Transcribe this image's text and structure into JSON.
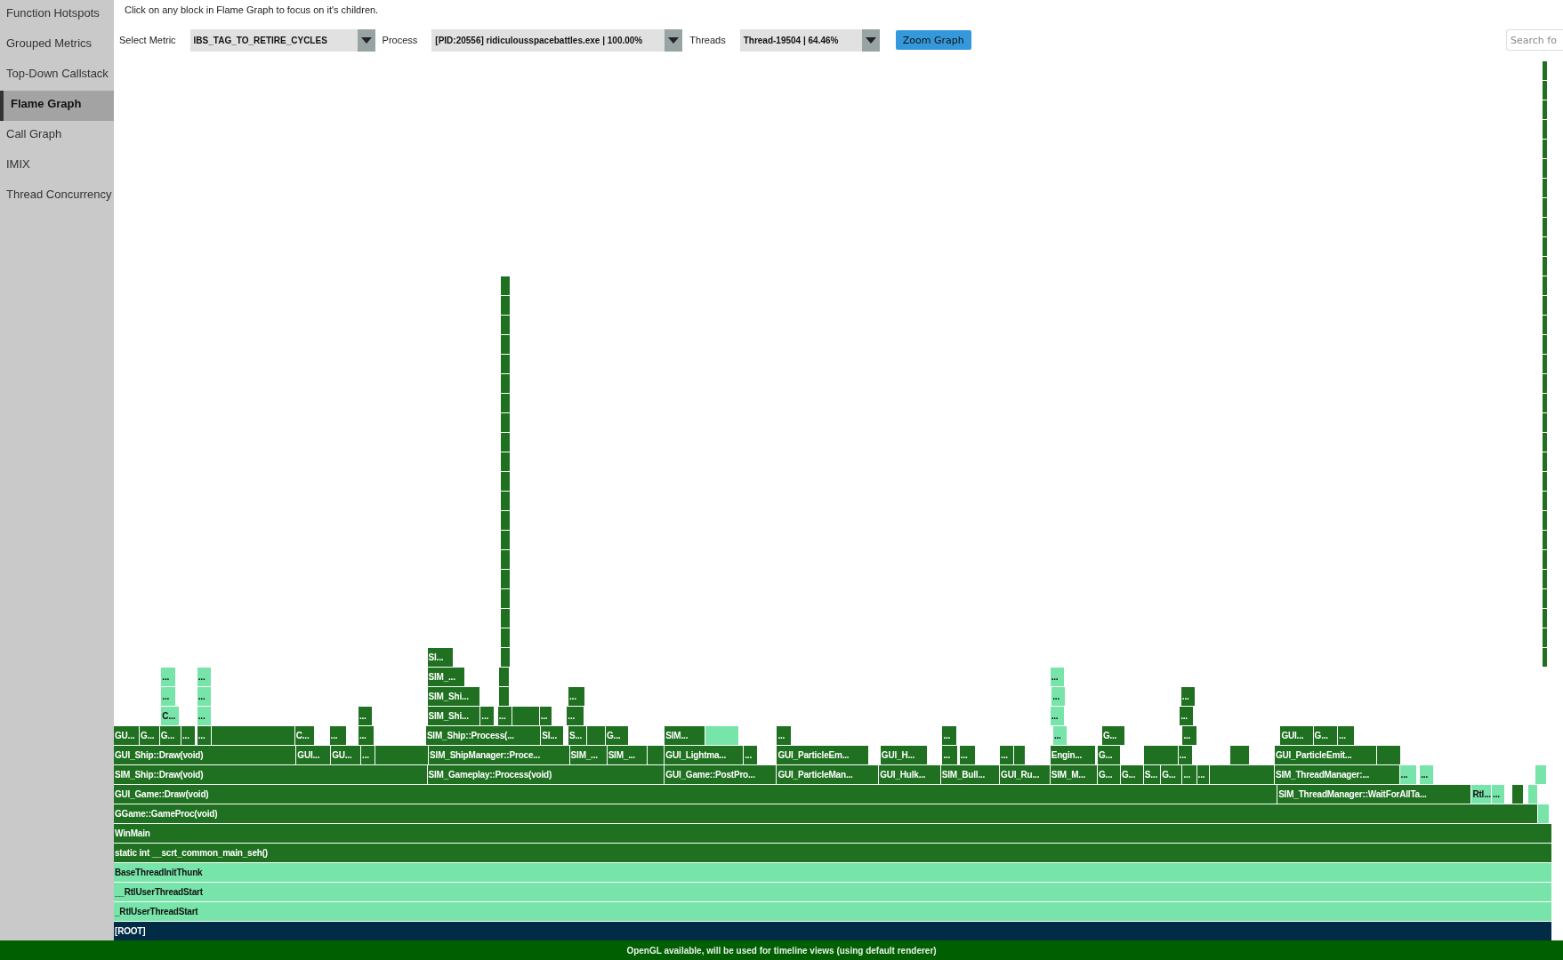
{
  "sidebar": {
    "items": [
      {
        "label": "Function Hotspots",
        "selected": false
      },
      {
        "label": "Grouped Metrics",
        "selected": false
      },
      {
        "label": "Top-Down Callstack",
        "selected": false
      },
      {
        "label": "Flame Graph",
        "selected": true
      },
      {
        "label": "Call Graph",
        "selected": false
      },
      {
        "label": "IMIX",
        "selected": false
      },
      {
        "label": "Thread Concurrency",
        "selected": false
      }
    ]
  },
  "hint": "Click on any block in Flame Graph to focus on it's children.",
  "toolbar": {
    "dropdowns": [
      {
        "label": "Select Metric",
        "value": "IBS_TAG_TO_RETIRE_CYCLES"
      },
      {
        "label": "Process",
        "value": "[PID:20556] ridiculousspacebattles.exe | 100.00%"
      },
      {
        "label": "Threads",
        "value": "Thread-19504 | 64.46%"
      }
    ],
    "button": "Zoom Graph",
    "search": {
      "placeholder": "Search fo"
    }
  },
  "flame_graph": {
    "rows": [
      {
        "blocks": [
          {
            "kind": "dark"
          }
        ]
      },
      {
        "blocks": [
          {
            "kind": "dark"
          }
        ]
      },
      {
        "blocks": [
          {
            "kind": "dark"
          }
        ]
      },
      {
        "blocks": [
          {
            "kind": "dark"
          }
        ]
      },
      {
        "blocks": [
          {
            "kind": "dark"
          }
        ]
      },
      {
        "blocks": [
          {
            "kind": "dark"
          }
        ]
      },
      {
        "blocks": [
          {
            "kind": "dark"
          }
        ]
      },
      {
        "blocks": [
          {
            "kind": "dark"
          }
        ]
      },
      {
        "blocks": [
          {
            "kind": "dark"
          }
        ]
      },
      {
        "blocks": [
          {
            "kind": "dark"
          }
        ]
      },
      {
        "blocks": [
          {
            "kind": "dark"
          }
        ]
      },
      {
        "blocks": [
          {
            "kind": "dark"
          },
          {
            "kind": "dark"
          }
        ]
      },
      {
        "blocks": [
          {
            "kind": "dark"
          },
          {
            "kind": "dark"
          }
        ]
      },
      {
        "blocks": [
          {
            "kind": "dark"
          },
          {
            "kind": "dark"
          }
        ]
      },
      {
        "blocks": [
          {
            "kind": "dark"
          },
          {
            "kind": "dark"
          }
        ]
      },
      {
        "blocks": [
          {
            "kind": "dark"
          },
          {
            "kind": "dark"
          }
        ]
      },
      {
        "blocks": [
          {
            "kind": "dark"
          },
          {
            "kind": "dark"
          }
        ]
      },
      {
        "blocks": [
          {
            "kind": "dark"
          },
          {
            "kind": "dark"
          }
        ]
      },
      {
        "blocks": [
          {
            "kind": "dark"
          },
          {
            "kind": "dark"
          }
        ]
      },
      {
        "blocks": [
          {
            "kind": "dark"
          },
          {
            "kind": "dark"
          }
        ]
      },
      {
        "blocks": [
          {
            "kind": "dark"
          },
          {
            "kind": "dark"
          }
        ]
      },
      {
        "blocks": [
          {
            "kind": "dark"
          },
          {
            "kind": "dark"
          }
        ]
      },
      {
        "blocks": [
          {
            "kind": "dark"
          },
          {
            "kind": "dark"
          }
        ]
      },
      {
        "blocks": [
          {
            "kind": "dark"
          },
          {
            "kind": "dark"
          }
        ]
      },
      {
        "blocks": [
          {
            "kind": "dark"
          },
          {
            "kind": "dark"
          }
        ]
      },
      {
        "blocks": [
          {
            "kind": "dark"
          },
          {
            "kind": "dark"
          }
        ]
      },
      {
        "blocks": [
          {
            "kind": "dark"
          },
          {
            "kind": "dark"
          }
        ]
      },
      {
        "blocks": [
          {
            "kind": "dark"
          },
          {
            "kind": "dark"
          }
        ]
      },
      {
        "blocks": [
          {
            "kind": "dark"
          },
          {
            "kind": "dark"
          }
        ]
      },
      {
        "blocks": [
          {
            "kind": "dark"
          },
          {
            "kind": "dark"
          }
        ]
      },
      {
        "blocks": [
          {
            "kind": "dark",
            "label": "SI..."
          },
          {
            "kind": "dark"
          },
          {
            "kind": "dark"
          }
        ]
      },
      {
        "blocks": [
          {
            "kind": "light",
            "label": "..."
          },
          {
            "kind": "light",
            "label": "..."
          },
          {
            "kind": "dark",
            "label": "SIM_..."
          },
          {
            "kind": "dark"
          },
          {
            "kind": "light",
            "label": "..."
          }
        ]
      },
      {
        "blocks": [
          {
            "kind": "light",
            "label": "..."
          },
          {
            "kind": "light",
            "label": "..."
          },
          {
            "kind": "dark",
            "label": "SIM_Shi..."
          },
          {
            "kind": "dark"
          },
          {
            "kind": "dark",
            "label": "..."
          },
          {
            "kind": "light",
            "label": "..."
          },
          {
            "kind": "dark",
            "label": "..."
          }
        ]
      },
      {
        "blocks": [
          {
            "kind": "light",
            "label": "C..."
          },
          {
            "kind": "light",
            "label": "..."
          },
          {
            "kind": "dark",
            "label": "..."
          },
          {
            "kind": "dark",
            "label": "SIM_Shi..."
          },
          {
            "kind": "dark",
            "label": "..."
          },
          {
            "kind": "dark",
            "label": "..."
          },
          {
            "kind": "dark"
          },
          {
            "kind": "dark",
            "label": "..."
          },
          {
            "kind": "dark",
            "label": "..."
          },
          {
            "kind": "light",
            "label": "..."
          },
          {
            "kind": "dark",
            "label": "..."
          }
        ]
      },
      {
        "blocks": [
          {
            "kind": "dark",
            "label": "GU..."
          },
          {
            "kind": "dark",
            "label": "G..."
          },
          {
            "kind": "dark",
            "label": "G..."
          },
          {
            "kind": "dark",
            "label": "..."
          },
          {
            "kind": "dark",
            "label": "..."
          },
          {
            "kind": "dark"
          },
          {
            "kind": "dark",
            "label": "C..."
          },
          {
            "kind": "dark",
            "label": "..."
          },
          {
            "kind": "dark",
            "label": "..."
          },
          {
            "kind": "dark",
            "label": "SIM_Ship::Process(..."
          },
          {
            "kind": "dark",
            "label": "SI..."
          },
          {
            "kind": "dark",
            "label": "S..."
          },
          {
            "kind": "dark"
          },
          {
            "kind": "dark",
            "label": "G..."
          },
          {
            "kind": "dark",
            "label": "SIM..."
          },
          {
            "kind": "light"
          },
          {
            "kind": "dark",
            "label": "..."
          },
          {
            "kind": "dark",
            "label": "..."
          },
          {
            "kind": "light",
            "label": "..."
          },
          {
            "kind": "dark",
            "label": "G..."
          },
          {
            "kind": "dark",
            "label": "..."
          },
          {
            "kind": "dark",
            "label": "GUI..."
          },
          {
            "kind": "dark",
            "label": "G..."
          },
          {
            "kind": "dark",
            "label": "..."
          }
        ]
      },
      {
        "blocks": [
          {
            "kind": "dark",
            "label": "GUI_Ship::Draw(void)"
          },
          {
            "kind": "dark",
            "label": "GUI..."
          },
          {
            "kind": "dark",
            "label": "GU..."
          },
          {
            "kind": "dark",
            "label": "..."
          },
          {
            "kind": "dark"
          },
          {
            "kind": "dark",
            "label": "SIM_ShipManager::Proce..."
          },
          {
            "kind": "dark",
            "label": "SIM_..."
          },
          {
            "kind": "dark",
            "label": "SIM_..."
          },
          {
            "kind": "dark"
          },
          {
            "kind": "dark",
            "label": "GUI_Lightma..."
          },
          {
            "kind": "dark",
            "label": "..."
          },
          {
            "kind": "dark",
            "label": "GUI_ParticleEm..."
          },
          {
            "kind": "dark",
            "label": "GUI_H..."
          },
          {
            "kind": "dark",
            "label": "..."
          },
          {
            "kind": "dark",
            "label": "..."
          },
          {
            "kind": "dark",
            "label": "..."
          },
          {
            "kind": "dark"
          },
          {
            "kind": "dark",
            "label": "Engin..."
          },
          {
            "kind": "dark",
            "label": "G..."
          },
          {
            "kind": "dark"
          },
          {
            "kind": "dark",
            "label": "..."
          },
          {
            "kind": "dark"
          },
          {
            "kind": "dark",
            "label": "GUI_ParticleEmit..."
          },
          {
            "kind": "dark"
          }
        ]
      },
      {
        "blocks": [
          {
            "kind": "dark",
            "label": "SIM_Ship::Draw(void)"
          },
          {
            "kind": "dark",
            "label": "SIM_Gameplay::Process(void)"
          },
          {
            "kind": "dark",
            "label": "GUI_Game::PostPro..."
          },
          {
            "kind": "dark",
            "label": "GUI_ParticleMan..."
          },
          {
            "kind": "dark",
            "label": "GUI_Hulk..."
          },
          {
            "kind": "dark",
            "label": "SIM_Bull..."
          },
          {
            "kind": "dark",
            "label": "GUI_Ru..."
          },
          {
            "kind": "dark",
            "label": "SIM_M..."
          },
          {
            "kind": "dark",
            "label": "G..."
          },
          {
            "kind": "dark",
            "label": "G..."
          },
          {
            "kind": "dark",
            "label": "S..."
          },
          {
            "kind": "dark",
            "label": "G..."
          },
          {
            "kind": "dark",
            "label": "..."
          },
          {
            "kind": "dark",
            "label": "..."
          },
          {
            "kind": "dark"
          },
          {
            "kind": "dark",
            "label": "SIM_ThreadManager:..."
          },
          {
            "kind": "light",
            "label": "..."
          },
          {
            "kind": "light",
            "label": "..."
          },
          {
            "kind": "light"
          }
        ]
      },
      {
        "blocks": [
          {
            "kind": "dark",
            "label": "GUI_Game::Draw(void)"
          },
          {
            "kind": "dark",
            "label": "SIM_ThreadManager::WaitForAllTa..."
          },
          {
            "kind": "light",
            "label": "Rtl..."
          },
          {
            "kind": "light",
            "label": "..."
          },
          {
            "kind": "dark"
          },
          {
            "kind": "light"
          }
        ]
      },
      {
        "blocks": [
          {
            "kind": "dark",
            "label": "GGame::GameProc(void)"
          },
          {
            "kind": "light"
          }
        ]
      },
      {
        "blocks": [
          {
            "kind": "dark",
            "label": "WinMain"
          }
        ]
      },
      {
        "blocks": [
          {
            "kind": "dark",
            "label": "static int __scrt_common_main_seh()"
          }
        ]
      },
      {
        "blocks": [
          {
            "kind": "light",
            "label": "BaseThreadInitThunk"
          }
        ]
      },
      {
        "blocks": [
          {
            "kind": "light",
            "label": "__RtlUserThreadStart"
          }
        ]
      },
      {
        "blocks": [
          {
            "kind": "light",
            "label": "_RtlUserThreadStart"
          }
        ]
      },
      {
        "blocks": [
          {
            "kind": "root",
            "label": "[ROOT]"
          }
        ]
      }
    ]
  },
  "status_bar": "OpenGL available, will be used for timeline views (using default renderer)"
}
